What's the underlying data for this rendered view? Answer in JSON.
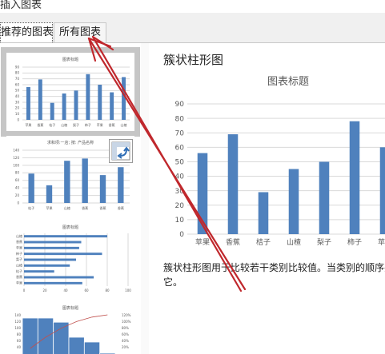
{
  "window": {
    "title": "插入图表"
  },
  "tabs": [
    {
      "label": "推荐的图表",
      "active": true
    },
    {
      "label": "所有图表",
      "active": false
    }
  ],
  "thumbnails": [
    {
      "title": "图表标题",
      "type": "bar",
      "categories": [
        "苹果",
        "香蕉",
        "桔子",
        "山楂",
        "梨子",
        "柿子",
        "苹果",
        "香蕉",
        "山楂"
      ],
      "values": [
        56,
        69,
        29,
        45,
        50,
        78,
        60,
        47,
        73
      ],
      "y_ticks": [
        "90",
        "80",
        "70",
        "60",
        "50",
        "40",
        "30",
        "20",
        "10",
        "0"
      ],
      "ylim": [
        0,
        90
      ]
    },
    {
      "title": "求和项:一店; 按: 产品名称",
      "type": "bar",
      "categories": [
        "桔子",
        "苹果",
        "山楂",
        "香蕉",
        "香蕉",
        "香蕉"
      ],
      "values": [
        78,
        47,
        112,
        118,
        74,
        95
      ],
      "y_ticks": [
        "140",
        "120",
        "100",
        "80",
        "60",
        "40",
        "20",
        "0"
      ],
      "ylim": [
        0,
        140
      ]
    },
    {
      "title": "图表标题",
      "type": "horizontal-bar",
      "categories": [
        "山楂",
        "香蕉",
        "苹果",
        "柿子",
        "梨子",
        "山楂",
        "桔子",
        "香蕉",
        "苹果"
      ],
      "values": [
        80,
        55,
        53,
        75,
        50,
        44,
        29,
        67,
        56
      ],
      "x_ticks": [
        "0",
        "20",
        "40",
        "60",
        "80",
        "100"
      ],
      "xlim": [
        0,
        100
      ]
    },
    {
      "title": "图表标题",
      "type": "pareto",
      "values": [
        130,
        130,
        117,
        70,
        55,
        20
      ],
      "cumulative": [
        0.25,
        0.5,
        0.7,
        0.85,
        0.95,
        1.0
      ],
      "y_ticks": [
        "140",
        "120",
        "100",
        "80",
        "60",
        "40"
      ],
      "y2_ticks": [
        "120%",
        "100%",
        "80%",
        "60%",
        "40%",
        "20%"
      ],
      "ylim": [
        0,
        140
      ]
    }
  ],
  "detail": {
    "chart_type_name": "簇状柱形图",
    "description_line1": "簇状柱形图用于比较若干类别比较值。当类别的顺序并",
    "description_line2": "它。"
  },
  "chart_data": {
    "type": "bar",
    "title": "图表标题",
    "categories": [
      "苹果",
      "香蕉",
      "桔子",
      "山楂",
      "梨子",
      "柿子",
      "苹果"
    ],
    "values": [
      56,
      69,
      29,
      45,
      50,
      78,
      60
    ],
    "y_ticks": [
      "90",
      "80",
      "70",
      "60",
      "50",
      "40",
      "30",
      "20",
      "10",
      "0"
    ],
    "ylim": [
      0,
      90
    ],
    "grid": true,
    "xlabel": "",
    "ylabel": ""
  },
  "colors": {
    "bar": "#4f81bd",
    "annotation_arrow": "#c0282d",
    "selection": "#c6c6c6",
    "gridline": "#d9d9d9"
  },
  "icons": {
    "swap": "swap-row-column-icon"
  }
}
